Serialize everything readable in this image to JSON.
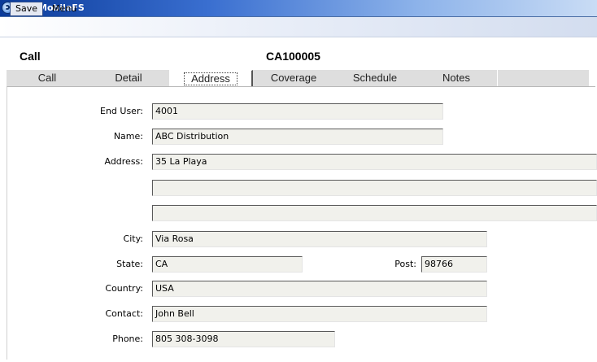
{
  "window": {
    "title": "QADMobileFS"
  },
  "menubar": {
    "save_label": "Save",
    "menu_label": "Menu"
  },
  "header": {
    "record_type": "Call",
    "record_id": "CA100005"
  },
  "tabs": [
    {
      "label": "Call",
      "active": false
    },
    {
      "label": "Detail",
      "active": false
    },
    {
      "label": "Address",
      "active": true
    },
    {
      "label": "Coverage",
      "active": false
    },
    {
      "label": "Schedule",
      "active": false
    },
    {
      "label": "Notes",
      "active": false
    }
  ],
  "form": {
    "end_user": {
      "label": "End User:",
      "value": "4001"
    },
    "name": {
      "label": "Name:",
      "value": "ABC Distribution"
    },
    "address": {
      "label": "Address:",
      "line1": "35 La Playa",
      "line2": "",
      "line3": ""
    },
    "city": {
      "label": "City:",
      "value": "Via Rosa"
    },
    "state": {
      "label": "State:",
      "value": "CA"
    },
    "post": {
      "label": "Post:",
      "value": "98766"
    },
    "country": {
      "label": "Country:",
      "value": "USA"
    },
    "contact": {
      "label": "Contact:",
      "value": "John Bell"
    },
    "phone": {
      "label": "Phone:",
      "value": "805 308-3098"
    }
  },
  "colors": {
    "titlebar_start": "#0a3a99",
    "tab_background": "#dedede",
    "field_background": "#f1f1ec"
  }
}
